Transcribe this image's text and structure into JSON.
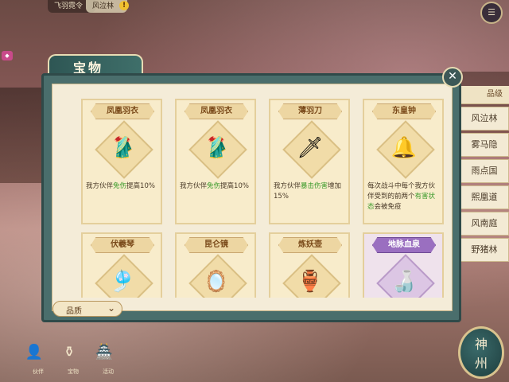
{
  "topbar": {
    "tab1": "飞羽霓令",
    "tab2": "风泣林",
    "alert": "!"
  },
  "panel": {
    "title": "宝物"
  },
  "cards": [
    {
      "name": "凤凰羽衣",
      "icon": "robe-icon",
      "glyph": "🥻",
      "desc_pre": "我方伙伴",
      "desc_hl": "免伤",
      "desc_post": "提高10%",
      "purple": false
    },
    {
      "name": "凤凰羽衣",
      "icon": "robe-icon",
      "glyph": "🥻",
      "desc_pre": "我方伙伴",
      "desc_hl": "免伤",
      "desc_post": "提高10%",
      "purple": false
    },
    {
      "name": "薄羽刀",
      "icon": "blade-icon",
      "glyph": "🗡",
      "desc_pre": "我方伙伴",
      "desc_hl": "暴击伤害",
      "desc_post": "增加15%",
      "purple": false
    },
    {
      "name": "东皇钟",
      "icon": "bell-icon",
      "glyph": "🔔",
      "desc_pre": "每次战斗中每个我方伙伴受到的前两个",
      "desc_hl": "有害状态",
      "desc_post": "会被免疫",
      "purple": false
    },
    {
      "name": "伏羲琴",
      "icon": "zither-icon",
      "glyph": "🎐",
      "desc_pre": "",
      "desc_hl": "",
      "desc_post": "",
      "purple": false
    },
    {
      "name": "昆仑镜",
      "icon": "mirror-icon",
      "glyph": "🪞",
      "desc_pre": "",
      "desc_hl": "",
      "desc_post": "",
      "purple": false
    },
    {
      "name": "炼妖壶",
      "icon": "pot-icon",
      "glyph": "🏺",
      "desc_pre": "",
      "desc_hl": "",
      "desc_post": "",
      "purple": false
    },
    {
      "name": "地脉血泉",
      "icon": "gourd-icon",
      "glyph": "🍶",
      "desc_pre": "",
      "desc_hl": "",
      "desc_post": "",
      "purple": true
    }
  ],
  "filter": {
    "label": "品质"
  },
  "side_list": {
    "header": "品级",
    "items": [
      "风泣林",
      "雾马隐",
      "雨点国",
      "熙凰道",
      "风南庭",
      "野猪林"
    ]
  },
  "bottom": {
    "icons": [
      {
        "label": "伙伴",
        "icon": "partner-icon",
        "glyph": "👤"
      },
      {
        "label": "宝物",
        "icon": "treasure-icon",
        "glyph": "⚱"
      },
      {
        "label": "活动",
        "icon": "event-icon",
        "glyph": "🏯"
      }
    ],
    "corner_line1": "神",
    "corner_line2": "州"
  }
}
